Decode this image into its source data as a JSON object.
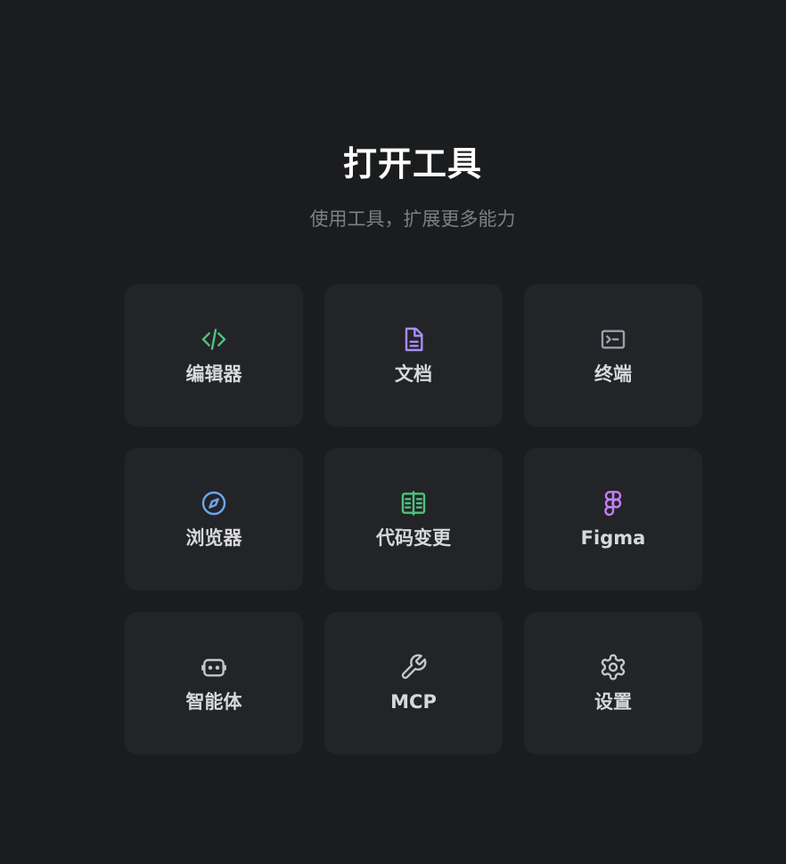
{
  "header": {
    "title": "打开工具",
    "subtitle": "使用工具，扩展更多能力"
  },
  "tools": [
    {
      "label": "编辑器",
      "icon": "code-icon",
      "color": "#4fc27e"
    },
    {
      "label": "文档",
      "icon": "document-icon",
      "color": "#a98ef7"
    },
    {
      "label": "终端",
      "icon": "terminal-icon",
      "color": "#9aa0ab"
    },
    {
      "label": "浏览器",
      "icon": "compass-icon",
      "color": "#6aa6f0"
    },
    {
      "label": "代码变更",
      "icon": "diff-icon",
      "color": "#4fc27e"
    },
    {
      "label": "Figma",
      "icon": "figma-icon",
      "color": "#c47ff3"
    },
    {
      "label": "智能体",
      "icon": "robot-icon",
      "color": "#c4c6cb"
    },
    {
      "label": "MCP",
      "icon": "wrench-icon",
      "color": "#c4c6cb"
    },
    {
      "label": "设置",
      "icon": "gear-icon",
      "color": "#c4c6cb"
    }
  ]
}
